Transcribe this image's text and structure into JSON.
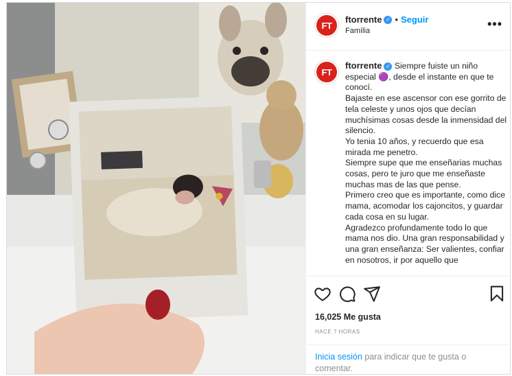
{
  "post": {
    "username": "ftorrente",
    "avatar_text": "FT",
    "verified_icon": "verified-badge-icon",
    "separator": "•",
    "follow_label": "Seguir",
    "location": "Família",
    "more_icon": "more-options-icon",
    "more_glyph": "•••",
    "caption_username": "ftorrente",
    "caption_text": "Siempre fuiste un niño especial 🟣, desde el instante en que te conocí.\nBajaste en ese ascensor con ese gorrito de tela celeste y unos ojos que decían muchísimas cosas desde la inmensidad del silencio.\nYo tenia 10 años, y recuerdo que esa mirada me penetro.\nSiempre supe que me enseñarias muchas cosas, pero te juro que me enseñaste muchas mas de las que pense.\nPrimero creo que es importante, como dice mama, acomodar los cajoncitos, y guardar cada cosa en su lugar.\nAgradezco profundamente todo lo que mama nos dio. Una gran responsabilidad y una gran enseñanza: Ser valientes, confiar en nosotros, ir por aquello que",
    "likes": "16,025 Me gusta",
    "time": "HACE 7 HORAS",
    "login_link": "Inicia sesión",
    "login_rest": " para indicar que te gusta o comentar."
  },
  "icons": {
    "like": "heart-icon",
    "comment": "comment-icon",
    "share": "share-icon",
    "save": "bookmark-icon"
  },
  "colors": {
    "link_blue": "#0095f6",
    "avatar_red": "#d9221c",
    "verified_blue": "#3897f0"
  }
}
